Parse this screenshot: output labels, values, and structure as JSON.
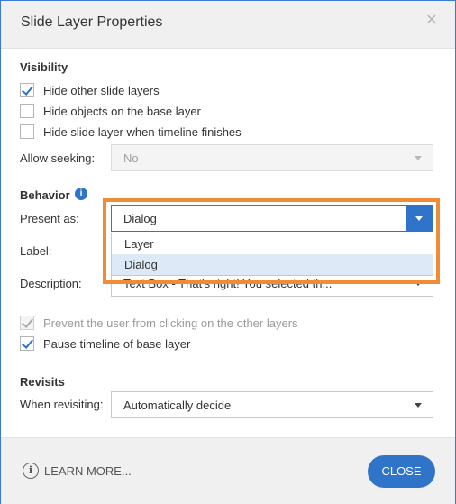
{
  "dialog": {
    "title": "Slide Layer Properties"
  },
  "visibility": {
    "heading": "Visibility",
    "hide_other_layers": {
      "label": "Hide other slide layers",
      "checked": true
    },
    "hide_base_objects": {
      "label": "Hide objects on the base layer",
      "checked": false
    },
    "hide_when_finishes": {
      "label": "Hide slide layer when timeline finishes",
      "checked": false
    },
    "allow_seeking": {
      "label": "Allow seeking:",
      "value": "No"
    }
  },
  "behavior": {
    "heading": "Behavior",
    "present_as": {
      "label": "Present as:",
      "value": "Dialog",
      "options": [
        "Layer",
        "Dialog"
      ],
      "selected": "Dialog"
    },
    "label_field": {
      "label": "Label:"
    },
    "description": {
      "label": "Description:",
      "value": "Text Box - That's right! You selected th..."
    },
    "prevent_clicking": {
      "label": "Prevent the user from clicking on the other layers",
      "checked": true,
      "disabled": true
    },
    "pause_timeline": {
      "label": "Pause timeline of base layer",
      "checked": true
    }
  },
  "revisits": {
    "heading": "Revisits",
    "when_revisiting": {
      "label": "When revisiting:",
      "value": "Automatically decide"
    }
  },
  "footer": {
    "learn_more": "LEARN MORE...",
    "close": "CLOSE"
  },
  "colors": {
    "accent": "#2f74c9",
    "highlight": "#f08c36",
    "frame": "#3a7bd5"
  }
}
